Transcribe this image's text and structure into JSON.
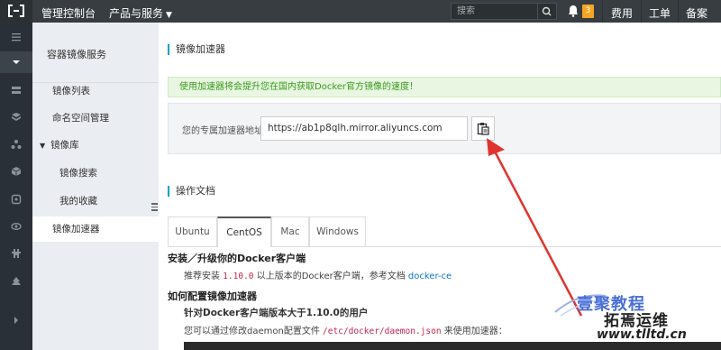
{
  "topbar": {
    "console_label": "管理控制台",
    "products_label": "产品与服务",
    "search_placeholder": "搜索",
    "notification_count": "3",
    "nav": [
      "费用",
      "工单",
      "备案"
    ]
  },
  "sidemenu": {
    "title": "容器镜像服务",
    "items": [
      "镜像列表",
      "命名空间管理",
      "镜像库",
      "镜像搜索",
      "我的收藏",
      "镜像加速器"
    ]
  },
  "main": {
    "accelerator_title": "镜像加速器",
    "notice": "使用加速器将会提升您在国内获取Docker官方镜像的速度！",
    "address_label": "您的专属加速器地址",
    "address_value": "https://ab1p8qlh.mirror.aliyuncs.com",
    "docs_title": "操作文档",
    "tabs": [
      "Ubuntu",
      "CentOS",
      "Mac",
      "Windows"
    ],
    "install_heading": "安装／升级你的Docker客户端",
    "install_text_a": "推荐安装",
    "install_version": "1.10.0",
    "install_text_b": "以上版本的Docker客户端，参考文档",
    "install_link": "docker-ce",
    "config_heading": "如何配置镜像加速器",
    "config_sub": "针对Docker客户端版本大于1.10.0的用户",
    "config_text_a": "您可以通过修改daemon配置文件",
    "config_path": "/etc/docker/daemon.json",
    "config_text_b": "来使用加速器："
  },
  "watermark": {
    "line1": "壹聚教程",
    "line2": "拓焉运维",
    "line3": "www.tlltd.cn"
  }
}
